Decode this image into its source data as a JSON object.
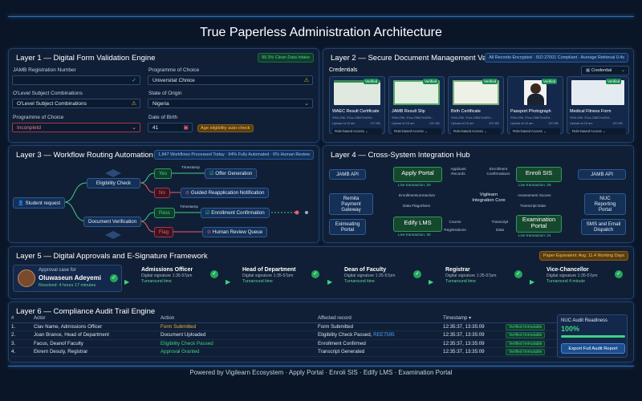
{
  "title": "True Paperless Administration Architecture",
  "layer1": {
    "title": "Layer 1 — Digital Form Validation Engine",
    "badge": "99.3% Clean Data Intake",
    "jamb_label": "JAMB Registration Number",
    "prog_choice_label": "Programme of Choice",
    "prog_choice_value": "Universitat Chnice",
    "olevel_label": "O'Level Subject Combinations",
    "olevel_value": "O'Level Subject Combinations",
    "state_label": "State of Origin",
    "state_value": "Nigeria",
    "prog2_label": "Programme of Choice",
    "prog2_value": "Inconpletd",
    "dob_label": "Date of Birth",
    "dob_value": "41",
    "age_chip": "Age eligibility auto-check"
  },
  "layer2": {
    "title": "Layer 2 — Secure Document Management Vault",
    "badge": "All Records Encrypted · ISO 27001 Compliant · Average Retrieval 0.4s",
    "credentials_label": "Credentials",
    "dropdown": "Credential",
    "verified": "Verified",
    "role_access": "Role-based Access",
    "docs": [
      {
        "name": "WAEC Result Certificate",
        "hash": "SHA-256: 37ca-23847ed204...",
        "upload": "Upload at 15 am",
        "size": "170 KB"
      },
      {
        "name": "JAMB Result Slip",
        "hash": "SHA-256: 37ca-23847ed204...",
        "upload": "Upload at 15 am",
        "size": "120 KB"
      },
      {
        "name": "Birth Certificate",
        "hash": "SHA-256: 37ca-23847ed204...",
        "upload": "Upload at 15 am",
        "size": "120 KB"
      },
      {
        "name": "Passport Photograph",
        "hash": "SHA-256: 37ca-23847ed204...",
        "upload": "Upload at 15 am",
        "size": "120 KB"
      },
      {
        "name": "Medical Fitness Form",
        "hash": "SHA-256: 37ca-23847ed204...",
        "upload": "Upload at 15 am",
        "size": "120 KB"
      }
    ]
  },
  "layer3": {
    "title": "Layer 3 — Workflow Routing Automation Engine",
    "badge": "1,847 Workflows Processed Today · 94% Fully Automated · 6% Human Review",
    "student_request": "Student request",
    "eligibility_check": "Eligibility Check",
    "document_verification": "Document Verification",
    "yes": "Yes",
    "no": "No",
    "pass": "Pass",
    "flag": "Flag",
    "timestamp": "Timestamp",
    "offer_generation": "Offer Generation",
    "guided_reapplication": "Guided Reapplication Notification",
    "enrollment_confirmation": "Enrollment Confirmation",
    "human_review": "Human Review Queue"
  },
  "layer4": {
    "title": "Layer 4 — Cross-System Integration Hub",
    "jamb_api_left": "JAMB API",
    "jamb_api_right": "JAMB API",
    "remita": "Remita Payment Gateway",
    "nuc": "NUC Reporting Portal",
    "exit_portal": "Eximeating Portal",
    "sms": "SMS and Email Dispatch",
    "hub": "Vigilearn Integration Core",
    "apply_portal": "Apply Portal",
    "enroll_sis": "Enroli SIS",
    "edify_lms": "Edify LMS",
    "exam_portal": "Examination Portal",
    "lt_apply": "Live transaction: 20",
    "lt_enroll": "Live transaction: 28",
    "lt_edify": "Live transaction: 30",
    "lt_exam": "Live transaction: 24",
    "applicant_records": "Applicant Records",
    "enrollment_confirmations": "Enrollment Confirmations",
    "enrollment_connection": "Enrollmentconnection",
    "data_flagorlines": "Data Flagorlines",
    "assessment_scores": "Assessment Scores",
    "transcript_data": "Transcript Data",
    "course_registrations": "Course Registrations",
    "transcript_data2": "Transcript Data"
  },
  "layer5": {
    "title": "Layer 5 — Digital Approvals and E-Signature Framework",
    "badge": "Paper Equivalent: Avg. 11.4 Working Days",
    "case_label": "Approval case for",
    "case_name": "Oluwaseun Adeyemi",
    "case_resolved": "Resolved: 4 hours 17 minutes",
    "stages": [
      {
        "name": "Admissions Officer",
        "sig": "Digital signature 1:35-57pm",
        "tat": "Turnaround time"
      },
      {
        "name": "Head of Department",
        "sig": "Digital signature 1:35-57pm",
        "tat": "Turnaround time"
      },
      {
        "name": "Dean of Faculty",
        "sig": "Digital signature 1:35-57pm",
        "tat": "Turnaround time"
      },
      {
        "name": "Registrar",
        "sig": "Digital signature 1:35-57pm",
        "tat": "Turnaround time"
      },
      {
        "name": "Vice-Chancellor",
        "sig": "Digital signature 1:35-57pm",
        "tat": "Turnaround 4 minute"
      }
    ]
  },
  "layer6": {
    "title": "Layer 6 — Compliance Audit Trail Engine",
    "headers": [
      "#",
      "Actor",
      "Action",
      "Affected record",
      "Timestamp"
    ],
    "rows": [
      {
        "n": "1.",
        "actor": "Clav Name,",
        "role": "Admissions Officer",
        "action": "Form Submitted",
        "record": "Form Submitted",
        "link": "",
        "ts": "12:35:37, 13:35:09",
        "status": "Verified Immutable",
        "acolor": "#f0b43b"
      },
      {
        "n": "2.",
        "actor": "Joan Brance,",
        "role": "Head of Department",
        "action": "Document Uploaded",
        "record": "Eligibility Check Passed,",
        "link": "REE7595",
        "ts": "12:35:37, 13:35:09",
        "status": "Verified Immutable",
        "acolor": "#dce6f2"
      },
      {
        "n": "3.",
        "actor": "Facus, Deanof Faculty",
        "role": "",
        "action": "Eligibility Check Passed",
        "record": "Enrollment Confirmed",
        "link": "",
        "ts": "12:35:37, 13:35:09",
        "status": "Verified Immutable",
        "acolor": "#3ed383"
      },
      {
        "n": "4.",
        "actor": "Ekrern Desuty,",
        "role": "Registrar",
        "action": "Approval Granted",
        "record": "Transcript Generated",
        "link": "",
        "ts": "12:35:37, 13:35:09",
        "status": "Verified Immutable",
        "acolor": "#3ed383"
      }
    ],
    "nuc_title": "NUC Audit Readiness",
    "nuc_value": "100%",
    "nuc_progress": 100,
    "export_button": "Export Full Audit Report"
  },
  "footer": "Powered by Vigilearn Ecosystem · Apply Portal · Enroli SIS · Edify LMS · Examination Portal"
}
